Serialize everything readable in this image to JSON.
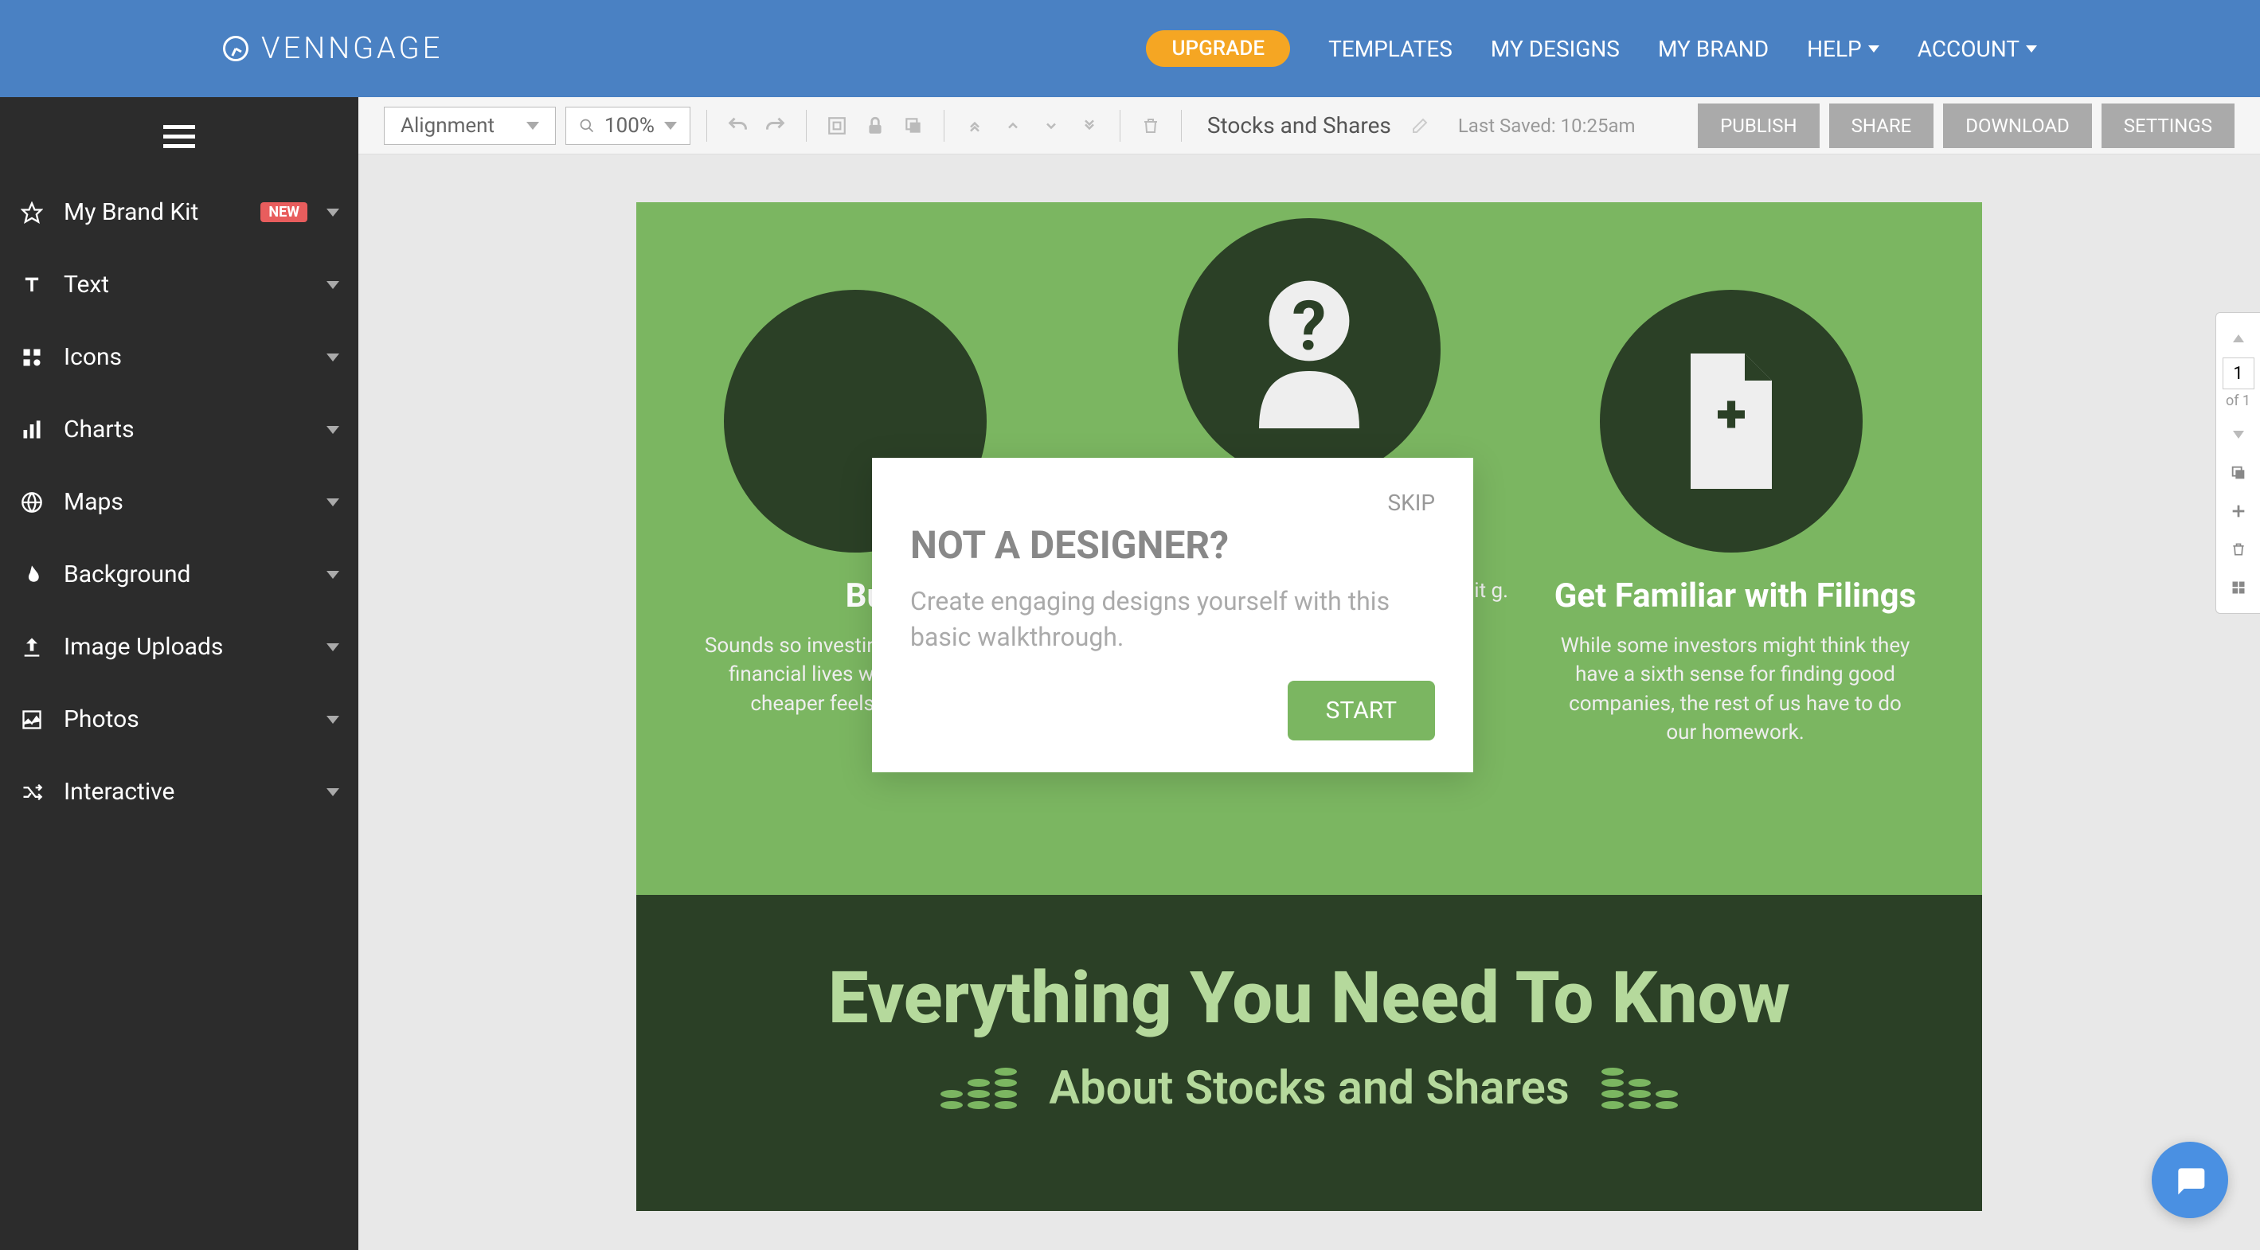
{
  "header": {
    "brand": "VENNGAGE",
    "upgrade": "UPGRADE",
    "nav": [
      "TEMPLATES",
      "MY DESIGNS",
      "MY BRAND",
      "HELP",
      "ACCOUNT"
    ]
  },
  "sidebar": {
    "items": [
      {
        "label": "My Brand Kit",
        "badge": "NEW"
      },
      {
        "label": "Text"
      },
      {
        "label": "Icons"
      },
      {
        "label": "Charts"
      },
      {
        "label": "Maps"
      },
      {
        "label": "Background"
      },
      {
        "label": "Image Uploads"
      },
      {
        "label": "Photos"
      },
      {
        "label": "Interactive"
      }
    ]
  },
  "toolbar": {
    "alignment": "Alignment",
    "zoom": "100%",
    "doc_title": "Stocks and Shares",
    "last_saved": "Last Saved: 10:25am",
    "actions": [
      "PUBLISH",
      "SHARE",
      "DOWNLOAD",
      "SETTINGS"
    ]
  },
  "canvas": {
    "columns": [
      {
        "title": "Buy L",
        "text": "Sounds so\n investing is a rare part of our financial lives where things getting cheaper feels like a bad thing."
      },
      {
        "title": "",
        "text": "tional t it g."
      },
      {
        "title": "Get Familiar with Filings",
        "text": "While some investors might think they have a sixth sense for finding good companies, the rest of us have to do our homework."
      }
    ],
    "big_title": "Everything You Need To Know",
    "sub_title": "About Stocks and Shares"
  },
  "right_panel": {
    "page": "1",
    "of": "of 1"
  },
  "modal": {
    "skip": "SKIP",
    "title": "NOT A DESIGNER?",
    "text": "Create engaging designs yourself with this basic walkthrough.",
    "start": "START"
  }
}
